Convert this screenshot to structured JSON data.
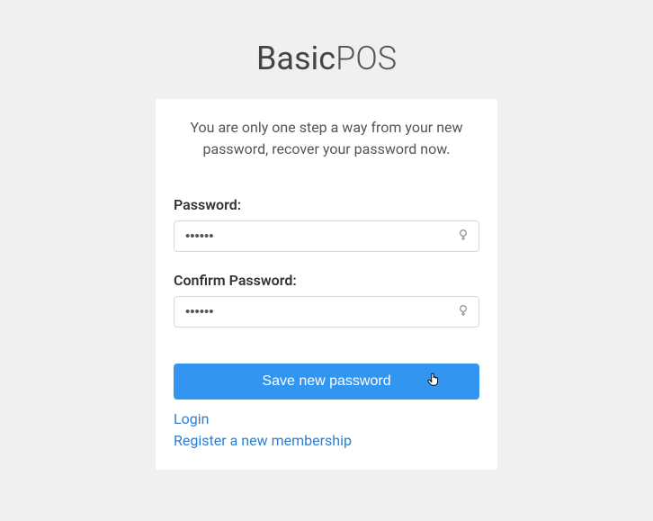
{
  "logo": {
    "bold": "Basic",
    "light": "POS"
  },
  "card": {
    "description": "You are only one step a way from your new password, recover your password now.",
    "password": {
      "label": "Password:",
      "value": "••••••"
    },
    "confirm_password": {
      "label": "Confirm Password:",
      "value": "••••••"
    },
    "submit_label": "Save new password",
    "links": {
      "login": "Login",
      "register": "Register a new membership"
    }
  }
}
